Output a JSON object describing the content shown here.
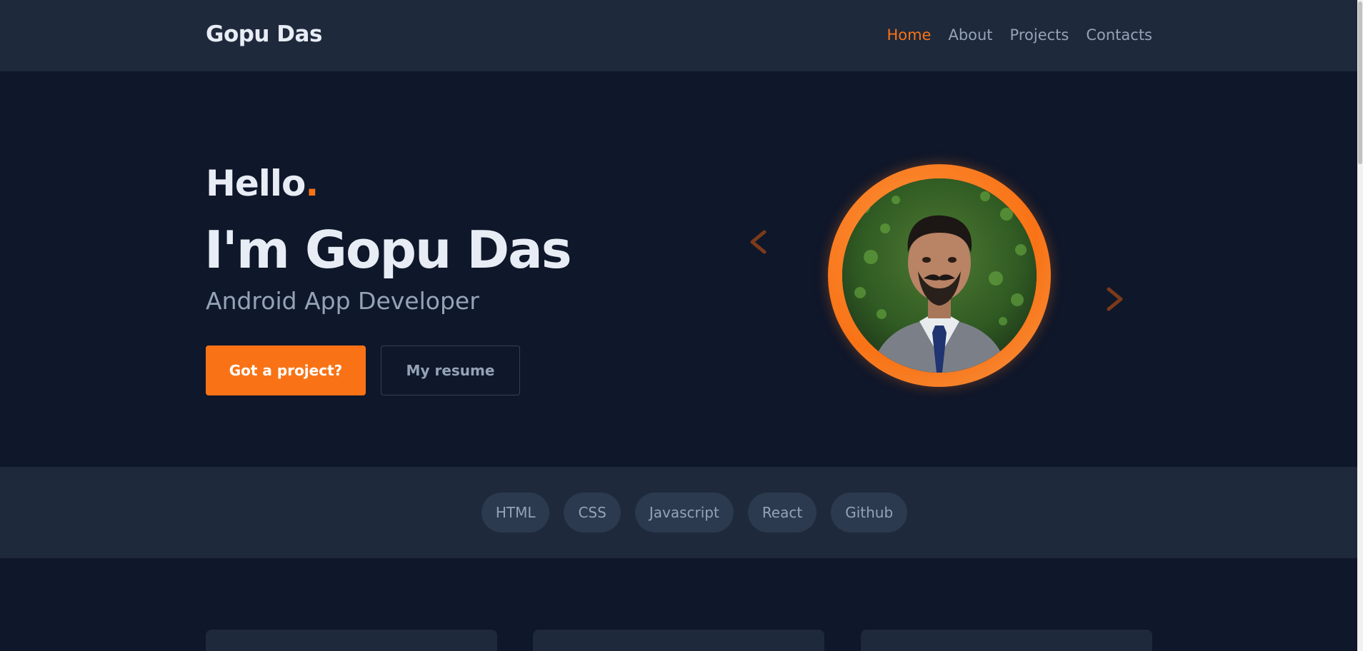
{
  "header": {
    "brand": "Gopu Das",
    "nav": [
      {
        "label": "Home",
        "active": true
      },
      {
        "label": "About",
        "active": false
      },
      {
        "label": "Projects",
        "active": false
      },
      {
        "label": "Contacts",
        "active": false
      }
    ]
  },
  "hero": {
    "greeting": "Hello",
    "greeting_dot": ".",
    "name": "I'm Gopu Das",
    "role": "Android App Developer",
    "primary_button": "Got a project?",
    "secondary_button": "My resume",
    "prev_arrow": "‹",
    "next_arrow": "›"
  },
  "skills": [
    "HTML",
    "CSS",
    "Javascript",
    "React",
    "Github"
  ],
  "colors": {
    "accent": "#f97316",
    "background": "#0f172a",
    "surface": "#1e293b",
    "muted_text": "#94a3b8"
  }
}
